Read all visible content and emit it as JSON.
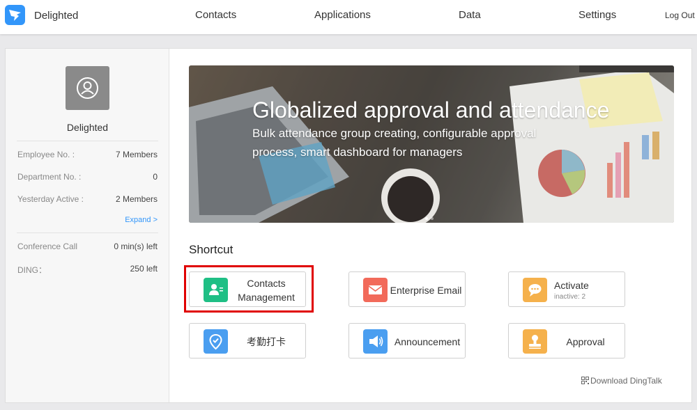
{
  "header": {
    "brand": "Delighted",
    "nav": [
      "Contacts",
      "Applications",
      "Data",
      "Settings"
    ],
    "logout": "Log Out",
    "accent_color": "#3296fa"
  },
  "sidebar": {
    "org_name": "Delighted",
    "stats": [
      {
        "label": "Employee No. :",
        "value": "7 Members"
      },
      {
        "label": "Department No. :",
        "value": "0"
      },
      {
        "label": "Yesterday Active :",
        "value": "2 Members"
      }
    ],
    "expand": "Expand >",
    "usage": [
      {
        "label": "Conference Call",
        "value": "0 min(s) left"
      },
      {
        "label": "DING：",
        "value": "250 left"
      }
    ]
  },
  "banner": {
    "title": "Globalized approval and attendance",
    "subtitle": "Bulk attendance group creating, configurable approval process, smart dashboard for managers"
  },
  "shortcuts": {
    "title": "Shortcut",
    "items": [
      {
        "label": "Contacts Management",
        "icon": "contacts-card-icon",
        "color": "#1fbf85"
      },
      {
        "label": "Enterprise Email",
        "icon": "mail-icon",
        "color": "#f26a5a"
      },
      {
        "label": "Activate",
        "sub": "inactive: 2",
        "icon": "chat-bubble-icon",
        "color": "#f5b14c"
      },
      {
        "label": "考勤打卡",
        "icon": "location-check-icon",
        "color": "#4a9ef0"
      },
      {
        "label": "Announcement",
        "icon": "megaphone-icon",
        "color": "#4a9ef0"
      },
      {
        "label": "Approval",
        "icon": "stamp-icon",
        "color": "#f5b14c"
      }
    ]
  },
  "footer": {
    "download": "Download DingTalk"
  }
}
